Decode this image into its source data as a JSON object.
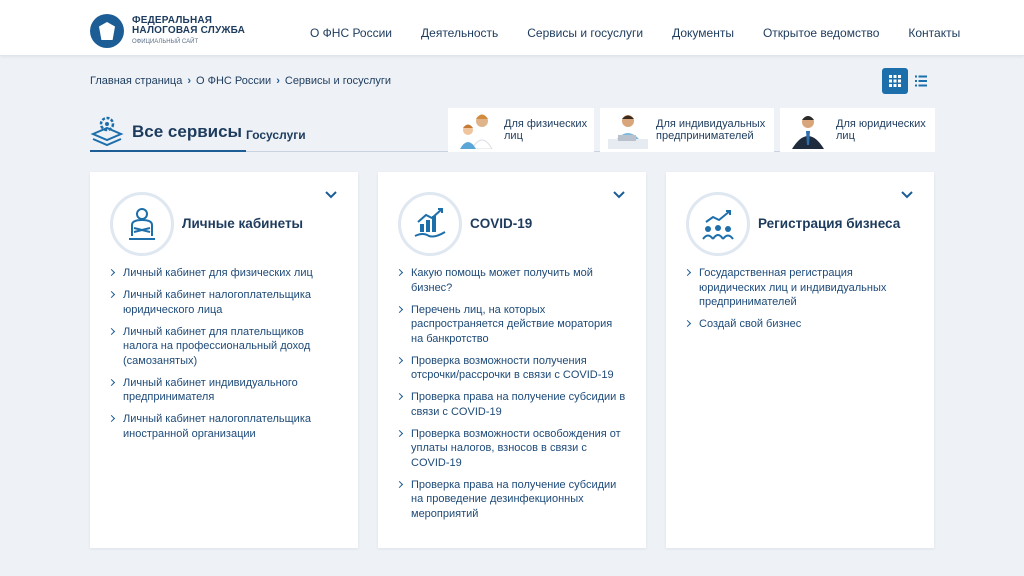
{
  "header": {
    "logo": {
      "line1": "ФЕДЕРАЛЬНАЯ",
      "line2": "НАЛОГОВАЯ СЛУЖБА",
      "line3": "ОФИЦИАЛЬНЫЙ САЙТ"
    },
    "nav": [
      "О ФНС России",
      "Деятельность",
      "Сервисы и госуслуги",
      "Документы",
      "Открытое ведомство",
      "Контакты"
    ]
  },
  "breadcrumb": [
    "Главная страница",
    "О ФНС России",
    "Сервисы и госуслуги"
  ],
  "services_bar": {
    "all_services": "Все сервисы",
    "gosuslugi": "Госуслуги",
    "audience_tabs": [
      {
        "label": "Для физических лиц",
        "icon": "family-photo"
      },
      {
        "label": "Для индивидуальных предпринимателей",
        "icon": "entrepreneur-photo"
      },
      {
        "label": "Для юридических лиц",
        "icon": "businessman-photo"
      }
    ]
  },
  "cards": [
    {
      "title": "Личные кабинеты",
      "icon": "person-icon",
      "links": [
        "Личный кабинет для физических лиц",
        "Личный кабинет налогоплательщика юридического лица",
        "Личный кабинет для плательщиков налога на профессиональный доход (самозанятых)",
        "Личный кабинет индивидуального предпринимателя",
        "Личный кабинет налогоплательщика иностранной организации"
      ]
    },
    {
      "title": "COVID-19",
      "icon": "growth-chart-icon",
      "links": [
        "Какую помощь может получить мой бизнес?",
        "Перечень лиц, на которых распространяется действие моратория на банкротство",
        "Проверка возможности получения отсрочки/рассрочки в связи с COVID-19",
        "Проверка права на получение субсидии в связи с COVID-19",
        "Проверка возможности освобождения от уплаты налогов, взносов в связи с COVID-19",
        "Проверка права на получение субсидии на проведение дезинфекционных мероприятий"
      ]
    },
    {
      "title": "Регистрация бизнеса",
      "icon": "team-growth-icon",
      "links": [
        "Государственная регистрация юридических лиц и индивидуальных предпринимателей",
        "Создай свой бизнес"
      ]
    }
  ],
  "colors": {
    "accent": "#1d5d96",
    "page_bg": "#eef2f7",
    "text": "#1d3b5d"
  }
}
